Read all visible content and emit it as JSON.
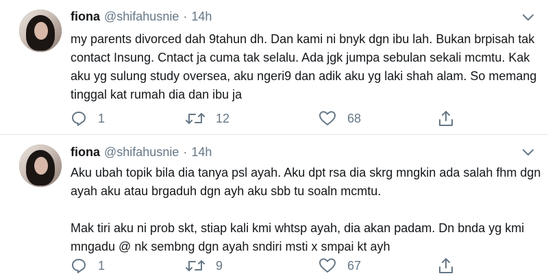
{
  "tweets": [
    {
      "author_name": "fiona",
      "handle": "@shifahusnie",
      "separator": "·",
      "time": "14h",
      "text": "my parents divorced dah 9tahun dh. Dan kami ni bnyk dgn ibu lah. Bukan brpisah tak contact Insung. Cntact ja cuma tak selalu. Ada jgk jumpa sebulan sekali mcmtu. Kak aku yg sulung study oversea, aku ngeri9 dan adik aku yg laki shah alam. So memang tinggal kat rumah dia dan ibu ja",
      "replies": "1",
      "retweets": "12",
      "likes": "68"
    },
    {
      "author_name": "fiona",
      "handle": "@shifahusnie",
      "separator": "·",
      "time": "14h",
      "text": "Aku ubah topik bila dia tanya psl ayah. Aku dpt rsa dia skrg mngkin ada salah fhm dgn ayah aku atau brgaduh dgn ayh aku sbb tu soaln mcmtu.\n\nMak tiri aku ni prob skt, stiap kali kmi whtsp ayah, dia akan padam. Dn bnda yg kmi mngadu @ nk sembng dgn ayah sndiri msti x smpai kt ayh",
      "replies": "1",
      "retweets": "9",
      "likes": "67"
    }
  ],
  "icons": {
    "reply": "reply-icon",
    "retweet": "retweet-icon",
    "like": "heart-icon",
    "share": "share-icon",
    "menu": "chevron-down-icon"
  },
  "colors": {
    "text": "#14171a",
    "muted": "#657786",
    "divider": "#e1e8ed"
  }
}
